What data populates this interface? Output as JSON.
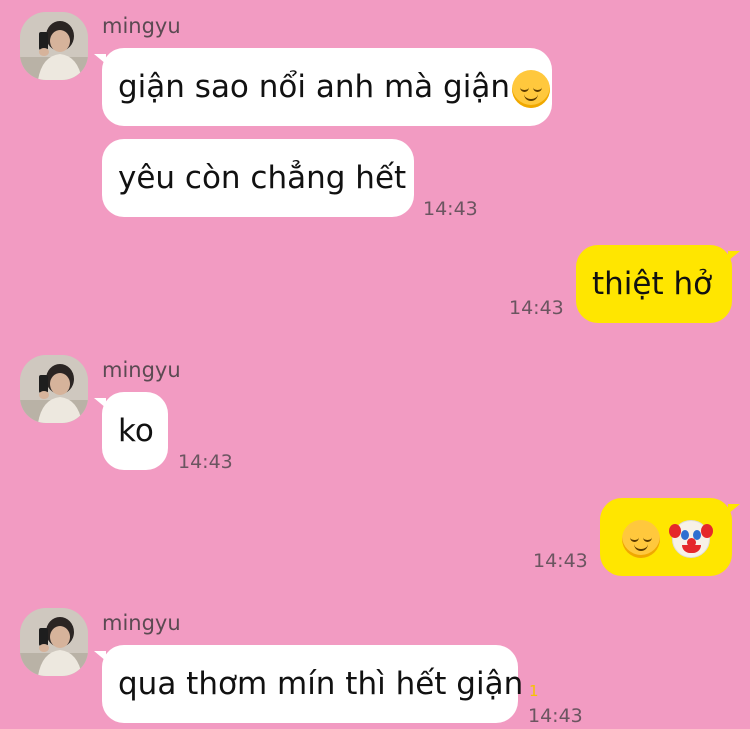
{
  "chat": {
    "sender_name": "mingyu",
    "messages": {
      "m1": {
        "text": "giận sao nổi anh mà giận",
        "emoji": "smiling-face-icon"
      },
      "m2": {
        "text": "yêu còn chẳng hết",
        "time": "14:43"
      },
      "m3": {
        "text": "thiệt hở",
        "time": "14:43"
      },
      "m4": {
        "text": "ko",
        "time": "14:43"
      },
      "m5": {
        "emojis": [
          "smiling-face-icon",
          "clown-face-icon"
        ],
        "time": "14:43"
      },
      "m6": {
        "text": "qua thơm mín thì hết giận",
        "time": "14:43",
        "unread": "1"
      }
    }
  },
  "colors": {
    "background": "#f29bc2",
    "incoming_bubble": "#ffffff",
    "outgoing_bubble": "#ffe600",
    "unread": "#f5c400"
  }
}
